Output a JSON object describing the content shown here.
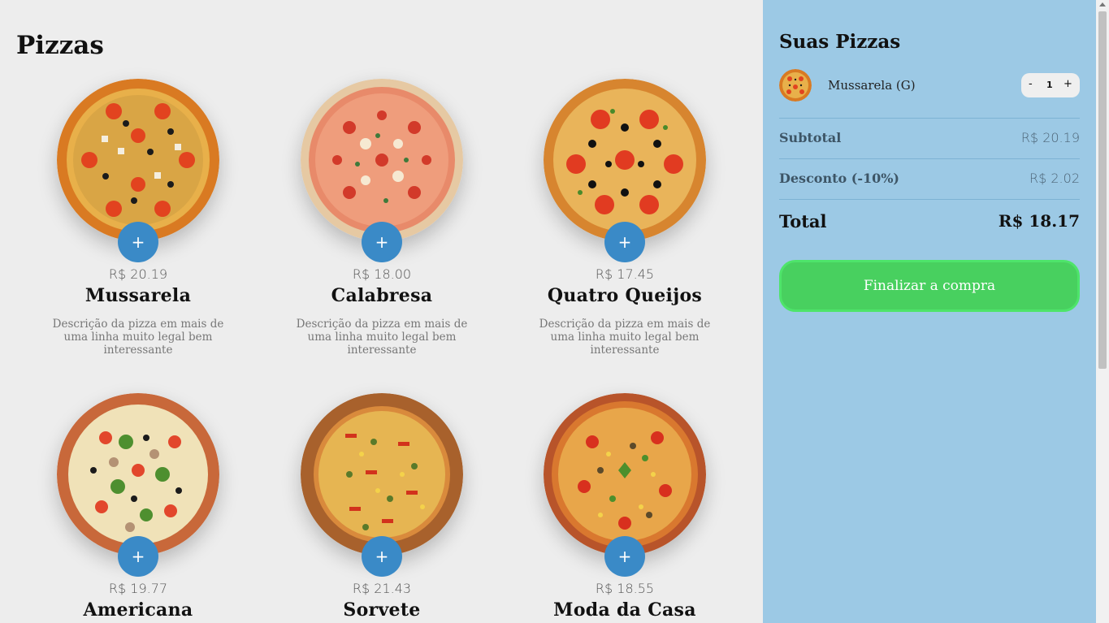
{
  "menu": {
    "title": "Pizzas",
    "add_label": "+",
    "items": [
      {
        "name": "Mussarela",
        "price": "R$ 20.19",
        "description": "Descrição da pizza em mais de uma linha muito legal bem interessante"
      },
      {
        "name": "Calabresa",
        "price": "R$ 18.00",
        "description": "Descrição da pizza em mais de uma linha muito legal bem interessante"
      },
      {
        "name": "Quatro Queijos",
        "price": "R$ 17.45",
        "description": "Descrição da pizza em mais de uma linha muito legal bem interessante"
      },
      {
        "name": "Americana",
        "price": "R$ 19.77",
        "description": ""
      },
      {
        "name": "Sorvete",
        "price": "R$ 21.43",
        "description": ""
      },
      {
        "name": "Moda da Casa",
        "price": "R$ 18.55",
        "description": ""
      }
    ]
  },
  "cart": {
    "title": "Suas Pizzas",
    "items": [
      {
        "name": "Mussarela (G)",
        "qty_minus": "-",
        "qty": "1",
        "qty_plus": "+"
      }
    ],
    "subtotal_label": "Subtotal",
    "subtotal_value": "R$ 20.19",
    "discount_label": "Desconto (-10%)",
    "discount_value": "R$ 2.02",
    "total_label": "Total",
    "total_value": "R$ 18.17",
    "checkout_label": "Finalizar a compra"
  },
  "colors": {
    "background": "#ededed",
    "sidebar": "#9cc9e5",
    "add_button": "#3a8ac7",
    "checkout": "#48d05f"
  }
}
